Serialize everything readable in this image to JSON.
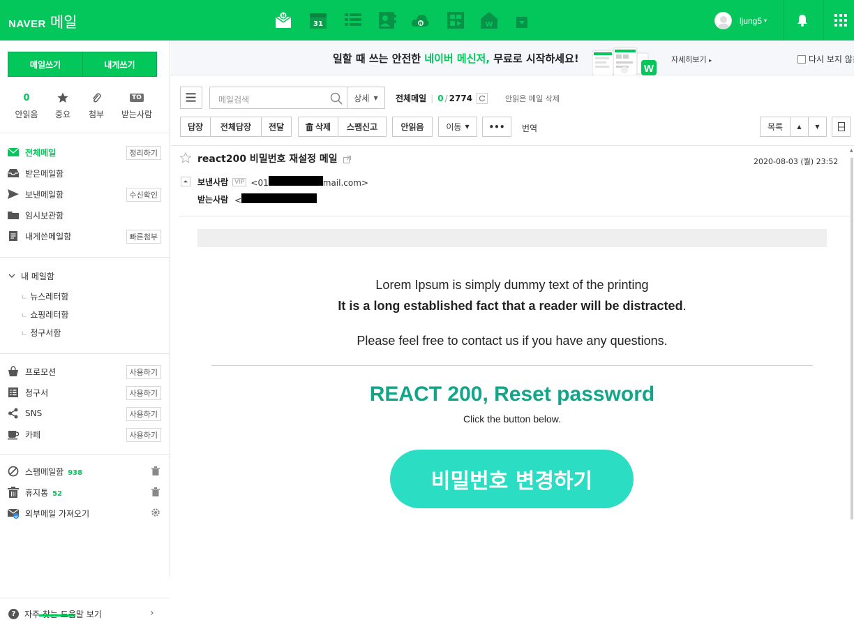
{
  "header": {
    "brand": "NAVER",
    "service": "메일",
    "calendar_day": "31",
    "username": "ljung5"
  },
  "compose": {
    "write_label": "메일쓰기",
    "self_label": "내게쓰기"
  },
  "quick_filters": [
    {
      "count": "0",
      "label": "안읽음"
    },
    {
      "label": "중요"
    },
    {
      "label": "첨부"
    },
    {
      "badge": "TO",
      "label": "받는사람"
    }
  ],
  "folders": {
    "all": {
      "label": "전체메일",
      "tag": "정리하기"
    },
    "inbox": {
      "label": "받은메일함"
    },
    "sent": {
      "label": "보낸메일함",
      "tag": "수신확인"
    },
    "drafts": {
      "label": "임시보관함"
    },
    "self": {
      "label": "내게쓴메일함",
      "tag": "빠른첨부"
    }
  },
  "my_mailbox": {
    "label": "내 메일함",
    "items": [
      "뉴스레터함",
      "쇼핑레터함",
      "청구서함"
    ]
  },
  "smart_folders": [
    {
      "label": "프로모션",
      "tag": "사용하기"
    },
    {
      "label": "청구서",
      "tag": "사용하기"
    },
    {
      "label": "SNS",
      "tag": "사용하기"
    },
    {
      "label": "카페",
      "tag": "사용하기"
    }
  ],
  "system_folders": {
    "spam": {
      "label": "스팸메일함",
      "count": "938"
    },
    "trash": {
      "label": "휴지통",
      "count": "52"
    },
    "external": {
      "label": "외부메일 가져오기"
    }
  },
  "help": {
    "label": "자주 찾는 도움말 보기"
  },
  "banner": {
    "text_before": "일할 때 쓰는 안전한 ",
    "text_highlight": "네이버 메신저,",
    "text_after": " 무료로 시작하세요!",
    "more": "자세히보기",
    "hide": "다시 보지 않음"
  },
  "toolbar": {
    "search_placeholder": "메일검색",
    "detail": "상세",
    "folder_title": "전체메일",
    "unread": "0",
    "total": "2774",
    "unread_delete": "안읽은 메일 삭제",
    "reply": "답장",
    "reply_all": "전체답장",
    "forward": "전달",
    "delete": "삭제",
    "spam": "스팸신고",
    "mark_unread": "안읽음",
    "move": "이동",
    "more": "•••",
    "translate": "번역",
    "list": "목록"
  },
  "mail": {
    "subject": "react200 비밀번호 재설정 메일",
    "date": "2020-08-03 (월) 23:52",
    "from_label": "보낸사람",
    "vip": "VIP",
    "from_prefix": "<01",
    "from_suffix": "mail.com>",
    "to_label": "받는사람",
    "to_prefix": "<"
  },
  "body": {
    "line1": "Lorem Ipsum is simply dummy text of the printing",
    "line2": "It is a long established fact that a reader will be distracted",
    "line2_end": ".",
    "line3": "Please feel free to contact us if you have any questions.",
    "title": "REACT 200, Reset password",
    "subtitle": "Click the button below.",
    "button": "비밀번호 변경하기"
  },
  "colors": {
    "brand_green": "#03c75a",
    "title_teal": "#12a58a",
    "button_mint": "#2bdec3"
  }
}
